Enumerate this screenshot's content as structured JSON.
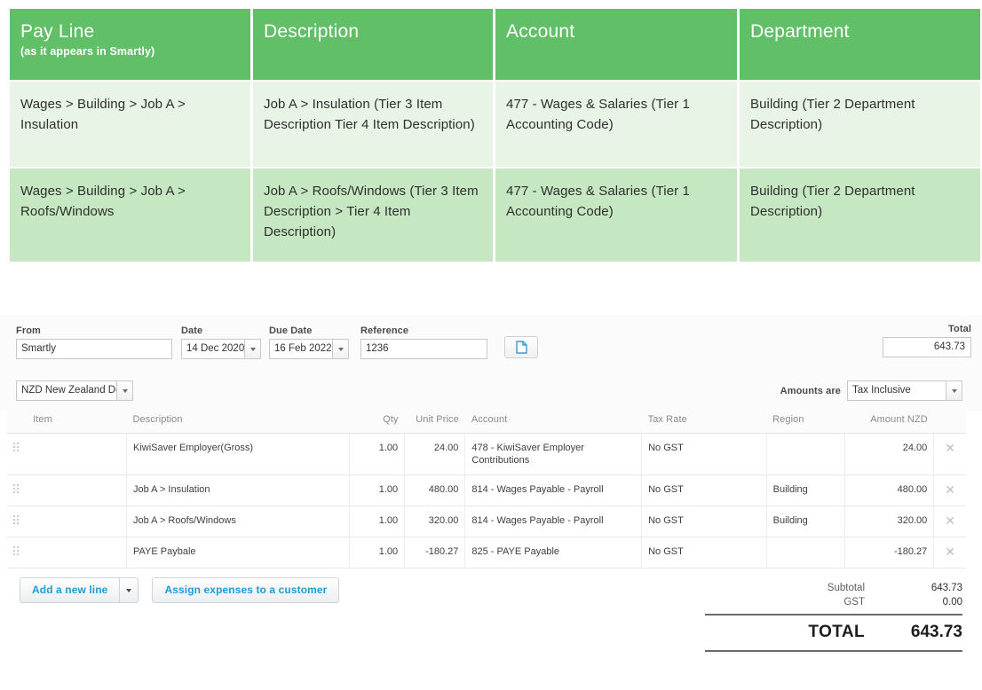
{
  "mapping_table": {
    "columns": [
      {
        "title": "Pay Line",
        "subtitle": "(as it appears in Smartly)"
      },
      {
        "title": "Description",
        "subtitle": ""
      },
      {
        "title": "Account",
        "subtitle": ""
      },
      {
        "title": "Department",
        "subtitle": ""
      }
    ],
    "rows": [
      {
        "pay_line": "Wages > Building > Job A > Insulation",
        "description": "Job A > Insulation (Tier 3 Item Description Tier 4 Item Description)",
        "account": "477 - Wages & Salaries (Tier 1 Accounting Code)",
        "department": "Building (Tier 2 Department Description)"
      },
      {
        "pay_line": "Wages > Building > Job A > Roofs/Windows",
        "description": "Job A > Roofs/Windows (Tier 3 Item Description > Tier 4 Item Description)",
        "account": "477 - Wages & Salaries (Tier 1 Accounting Code)",
        "department": "Building (Tier 2 Department Description)"
      }
    ],
    "colors": {
      "header_green": "#61bf68",
      "row_light_green": "#e8f4e5",
      "row_mid_green": "#c5e7c1"
    }
  },
  "bill": {
    "fields": {
      "from_label": "From",
      "from_value": "Smartly",
      "date_label": "Date",
      "date_value": "14 Dec 2020",
      "due_date_label": "Due Date",
      "due_date_value": "16 Feb 2022",
      "reference_label": "Reference",
      "reference_value": "1236",
      "total_label": "Total",
      "total_value": "643.73"
    },
    "currency": {
      "value": "NZD New Zealand Dollar",
      "amounts_are_label": "Amounts are",
      "amounts_are_value": "Tax Inclusive"
    },
    "line_table": {
      "headers": [
        "Item",
        "Description",
        "Qty",
        "Unit Price",
        "Account",
        "Tax Rate",
        "Region",
        "Amount NZD"
      ],
      "rows": [
        {
          "item": "",
          "description": "KiwiSaver Employer(Gross)",
          "qty": "1.00",
          "unit_price": "24.00",
          "account": "478 - KiwiSaver Employer Contributions",
          "tax_rate": "No GST",
          "region": "",
          "amount": "24.00"
        },
        {
          "item": "",
          "description": "Job A > Insulation",
          "qty": "1.00",
          "unit_price": "480.00",
          "account": "814 - Wages Payable - Payroll",
          "tax_rate": "No GST",
          "region": "Building",
          "amount": "480.00"
        },
        {
          "item": "",
          "description": "Job A > Roofs/Windows",
          "qty": "1.00",
          "unit_price": "320.00",
          "account": "814 - Wages Payable - Payroll",
          "tax_rate": "No GST",
          "region": "Building",
          "amount": "320.00"
        },
        {
          "item": "",
          "description": "PAYE Paybale",
          "qty": "1.00",
          "unit_price": "-180.27",
          "account": "825 - PAYE Payable",
          "tax_rate": "No GST",
          "region": "",
          "amount": "-180.27"
        }
      ]
    },
    "actions": {
      "add_line_label": "Add a new line",
      "assign_label": "Assign expenses to a customer"
    },
    "totals": {
      "subtotal_label": "Subtotal",
      "subtotal_value": "643.73",
      "gst_label": "GST",
      "gst_value": "0.00",
      "total_label": "TOTAL",
      "total_value": "643.73"
    },
    "colors": {
      "link_blue": "#1b9dd9",
      "panel_bg": "#fbfbfb"
    }
  }
}
